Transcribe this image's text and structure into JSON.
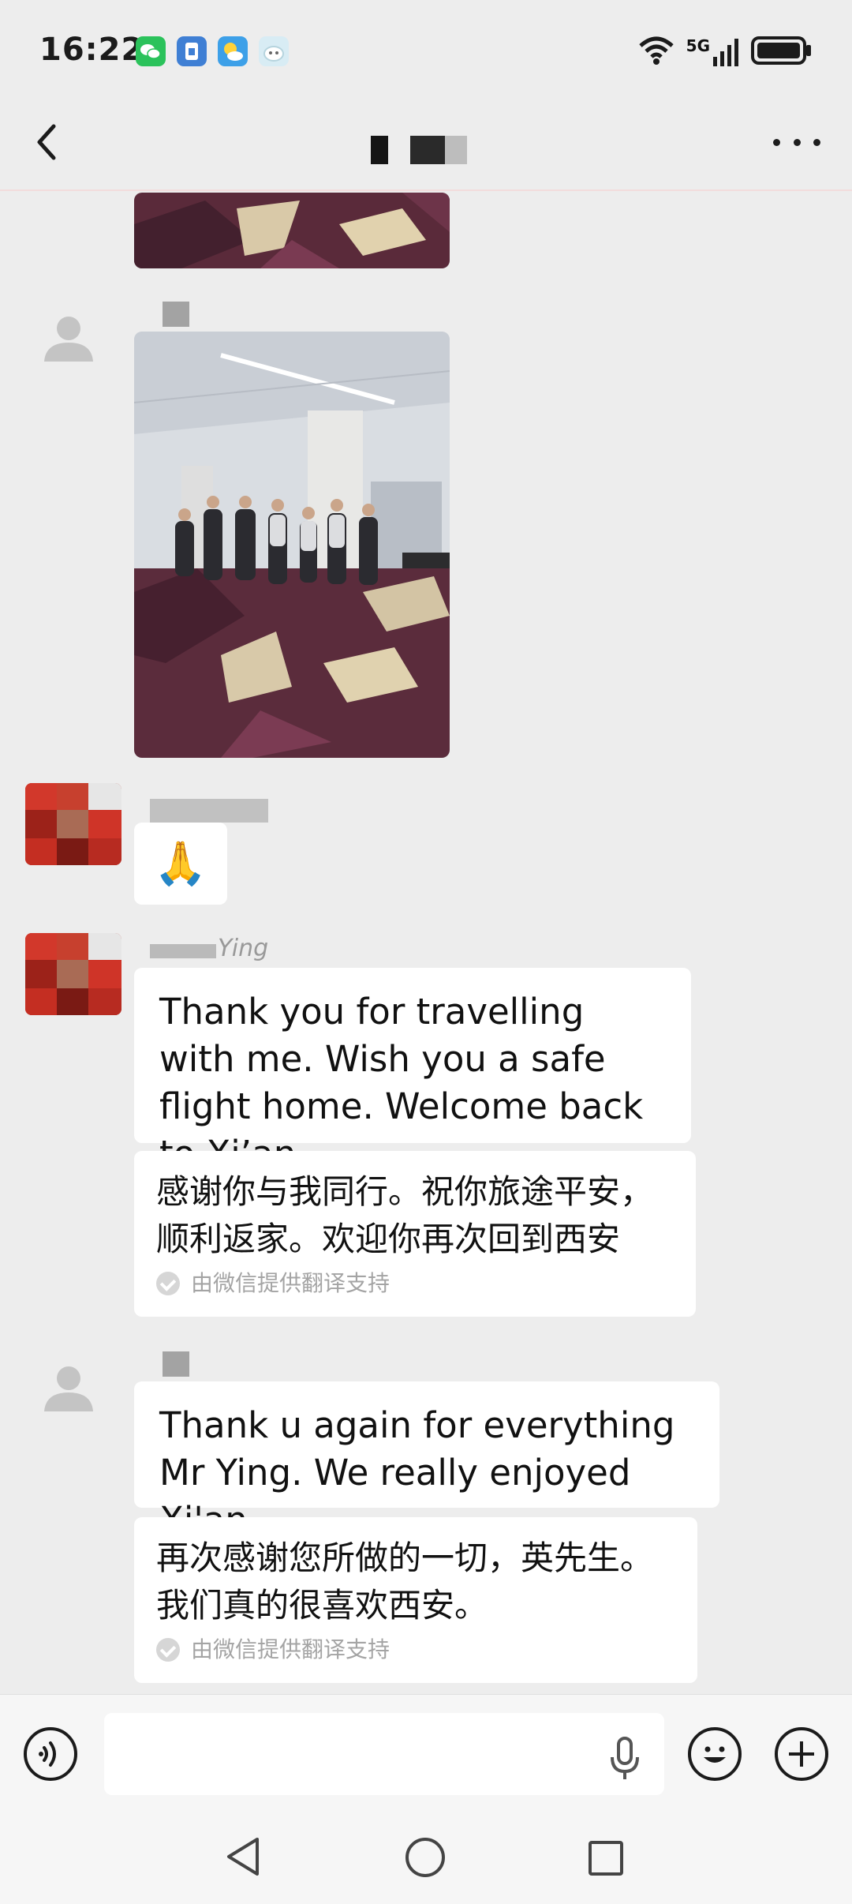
{
  "status_bar": {
    "time": "16:22",
    "app_icons": [
      "wechat-icon",
      "sim-icon",
      "weather-icon",
      "assistant-icon"
    ],
    "network": "5G",
    "icons": [
      "wifi-icon",
      "signal-icon",
      "battery-icon"
    ]
  },
  "nav": {
    "back_icon": "back-arrow-icon",
    "more_icon": "more-icon"
  },
  "messages": [
    {
      "type": "image",
      "sender": "other"
    },
    {
      "type": "image",
      "sender": "other"
    },
    {
      "type": "emoji",
      "sender": "other",
      "emoji": "🙏"
    },
    {
      "type": "text",
      "sender": "other",
      "name_suffix": "Ying",
      "text": "Thank you for travelling with me. Wish you a safe flight home. Welcome back to Xi’an",
      "translation": "感谢你与我同行。祝你旅途平安，顺利返家。欢迎你再次回到西安",
      "translation_note": "由微信提供翻译支持"
    },
    {
      "type": "text",
      "sender": "other",
      "text": "Thank u again for everything Mr Ying. We really enjoyed Xi'an.",
      "translation": "再次感谢您所做的一切，英先生。我们真的很喜欢西安。",
      "translation_note": "由微信提供翻译支持"
    }
  ],
  "input_bar": {
    "voice_icon": "voice-icon",
    "mic_icon": "mic-icon",
    "emoji_icon": "emoji-icon",
    "plus_icon": "plus-icon"
  },
  "system_nav": [
    "back-triangle-icon",
    "home-circle-icon",
    "recents-square-icon"
  ]
}
